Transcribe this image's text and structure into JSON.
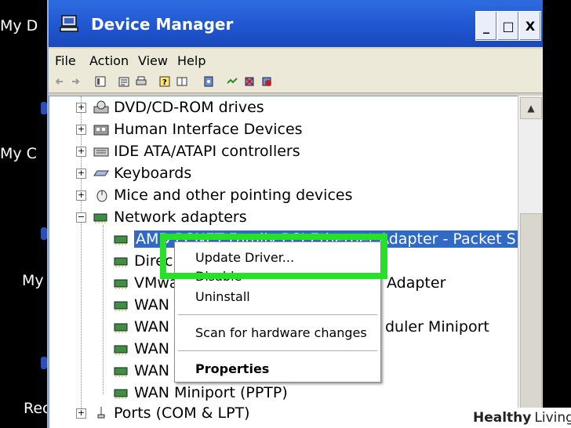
{
  "desktop": {
    "icons": [
      "My D",
      "My C",
      "My",
      "Rec"
    ]
  },
  "window": {
    "title": "Device Manager",
    "controls": [
      "_",
      "□",
      "X"
    ]
  },
  "menu": [
    "File",
    "Action",
    "View",
    "Help"
  ],
  "tree": {
    "items": [
      {
        "label": "DVD/CD-ROM drives",
        "icon": "dvd-drive-icon"
      },
      {
        "label": "Human Interface Devices",
        "icon": "hid-icon"
      },
      {
        "label": "IDE ATA/ATAPI controllers",
        "icon": "ide-controller-icon"
      },
      {
        "label": "Keyboards",
        "icon": "keyboard-icon"
      },
      {
        "label": "Mice and other pointing devices",
        "icon": "mouse-icon"
      },
      {
        "label": "Network adapters",
        "icon": "network-adapter-icon"
      }
    ],
    "network_children": [
      {
        "label": "AMD PCNET Family PCI Ethernet Adapter - Packet S"
      },
      {
        "label": "Direc"
      },
      {
        "label": "VMwa",
        "suffix": "Adapter"
      },
      {
        "label": "WAN"
      },
      {
        "label": "WAN",
        "suffix": "duler Miniport"
      },
      {
        "label": "WAN"
      },
      {
        "label": "WAN"
      },
      {
        "label": "WAN Miniport (PPTP)"
      }
    ],
    "ports": {
      "label": "Ports (COM & LPT)"
    }
  },
  "context_menu": {
    "update_driver": "Update Driver...",
    "disable": "Disable",
    "uninstall": "Uninstall",
    "scan": "Scan for hardware changes",
    "properties": "Properties"
  },
  "watermark": {
    "text_bold": "Healthy",
    "text": "Living"
  },
  "colors": {
    "selection": "#316ac5",
    "highlight": "#27e02a",
    "titlebar": "#1f55cf"
  }
}
